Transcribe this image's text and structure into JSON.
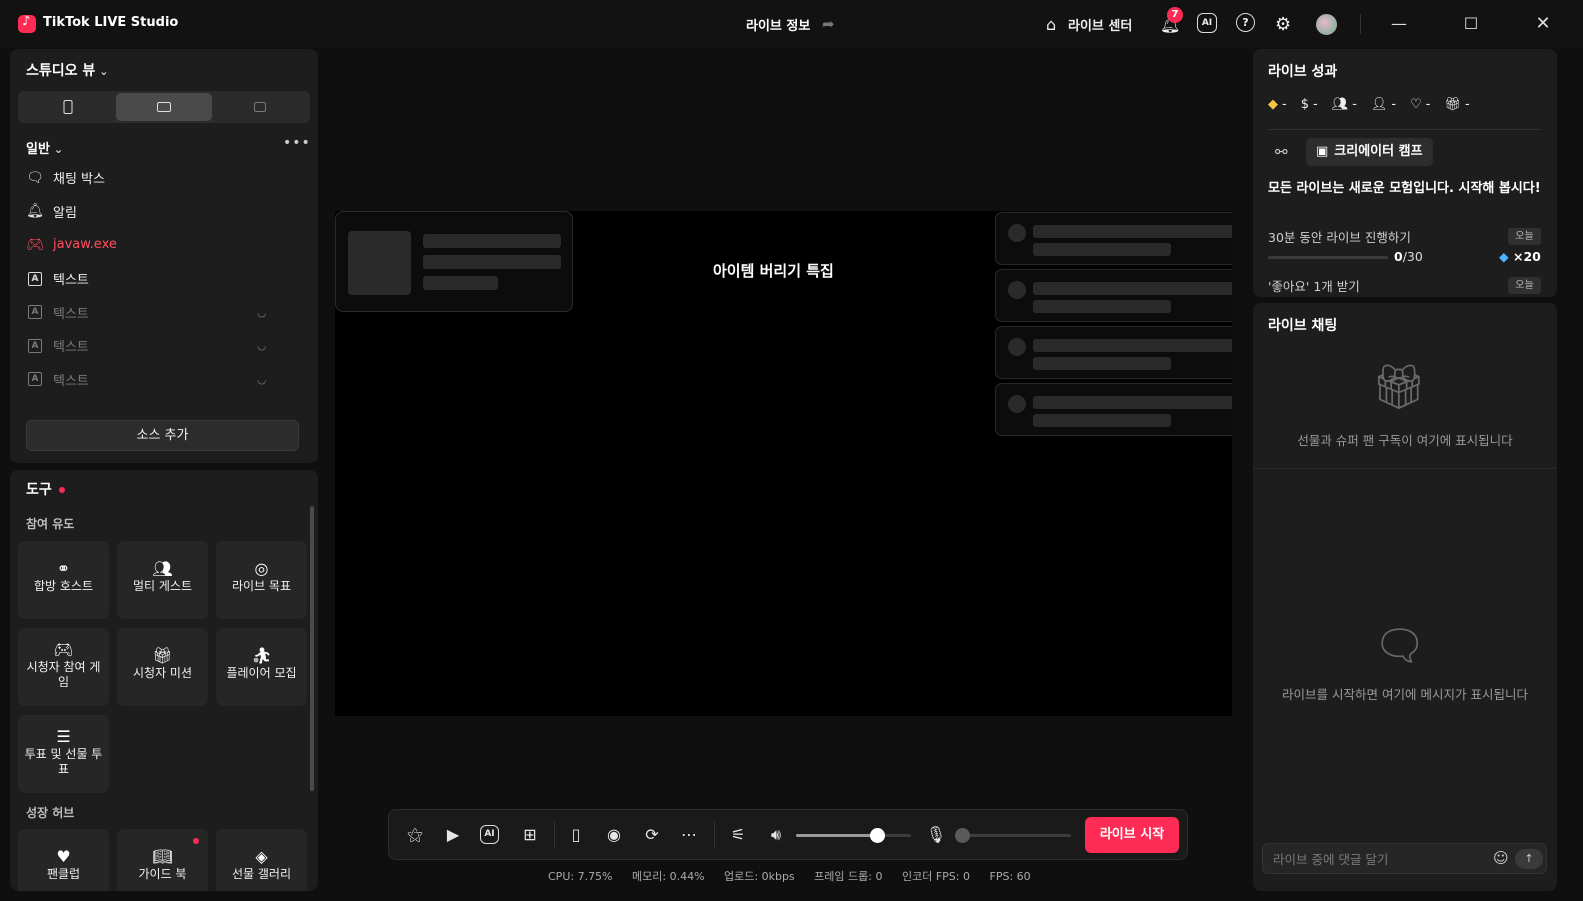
{
  "app": {
    "title": "TikTok LIVE Studio"
  },
  "titlebar": {
    "center_title": "라이브 정보",
    "live_center_label": "라이브 센터",
    "notification_count": "7",
    "ai_label": "AI",
    "help_label": "?"
  },
  "studio": {
    "heading": "스튜디오 뷰",
    "section_label": "일반",
    "sources": [
      {
        "label": "채팅 박스",
        "icon": "chat-box-icon",
        "state": "normal"
      },
      {
        "label": "알림",
        "icon": "bell-icon",
        "state": "normal"
      },
      {
        "label": "javaw.exe",
        "icon": "game-capture-icon",
        "state": "error"
      },
      {
        "label": "텍스트",
        "icon": "text-icon",
        "state": "normal"
      },
      {
        "label": "텍스트",
        "icon": "text-icon",
        "state": "hidden"
      },
      {
        "label": "텍스트",
        "icon": "text-icon",
        "state": "hidden"
      },
      {
        "label": "텍스트",
        "icon": "text-icon",
        "state": "hidden"
      }
    ],
    "add_source_label": "소스 추가"
  },
  "tools": {
    "heading": "도구",
    "engagement_label": "참여 유도",
    "growth_label": "성장 허브",
    "engagement_tiles": [
      {
        "label": "합방 호스트",
        "icon": "link-icon"
      },
      {
        "label": "멀티 게스트",
        "icon": "people-icon"
      },
      {
        "label": "라이브 목표",
        "icon": "target-icon"
      },
      {
        "label": "시청자 참여 게임",
        "icon": "gamepad-icon"
      },
      {
        "label": "시청자 미션",
        "icon": "gift-icon"
      },
      {
        "label": "플레이어 모집",
        "icon": "player-icon"
      },
      {
        "label": "투표 및 선물 투표",
        "icon": "poll-icon"
      }
    ],
    "growth_tiles": [
      {
        "label": "팬클럽",
        "icon": "heart-icon"
      },
      {
        "label": "가이드 북",
        "icon": "book-icon"
      },
      {
        "label": "선물 갤러리",
        "icon": "gallery-icon"
      }
    ]
  },
  "stage": {
    "title": "아이템 버리기 특집"
  },
  "controls": {
    "go_live_label": "라이브 시작",
    "volume_level": 0.7
  },
  "stats": {
    "cpu": "CPU:  7.75%",
    "memory": "메모리:  0.44%",
    "upload": "업로드:  0kbps",
    "frame_drop": "프레임 드롭:  0",
    "encoder_fps": "인코더 FPS:  0",
    "fps": "FPS:  60"
  },
  "performance": {
    "heading": "라이브 성과",
    "metrics": [
      {
        "icon": "diamond-icon",
        "value": "-"
      },
      {
        "icon": "dollar-icon",
        "value": "-"
      },
      {
        "icon": "viewers-icon",
        "value": "-"
      },
      {
        "icon": "new-followers-icon",
        "value": "-"
      },
      {
        "icon": "likes-icon",
        "value": "-"
      },
      {
        "icon": "gifts-icon",
        "value": "-"
      }
    ],
    "creator_camp_label": "크리에이터 캠프",
    "camp_message": "모든 라이브는 새로운 모험입니다. 시작해 봅시다!",
    "tasks": [
      {
        "title": "30분 동안 라이브 진행하기",
        "badge": "오늘",
        "progress_current": "0",
        "progress_total": "/30",
        "reward": "×20",
        "fraction": 0
      },
      {
        "title": "'좋아요' 1개 받기",
        "badge": "오늘"
      }
    ]
  },
  "chat": {
    "heading": "라이브 채팅",
    "gifts_empty": "선물과 슈퍼 팬 구독이 여기에 표시됩니다",
    "messages_empty": "라이브를 시작하면 여기에 메시지가 표시됩니다",
    "input_placeholder": "라이브 중에 댓글 달기"
  }
}
